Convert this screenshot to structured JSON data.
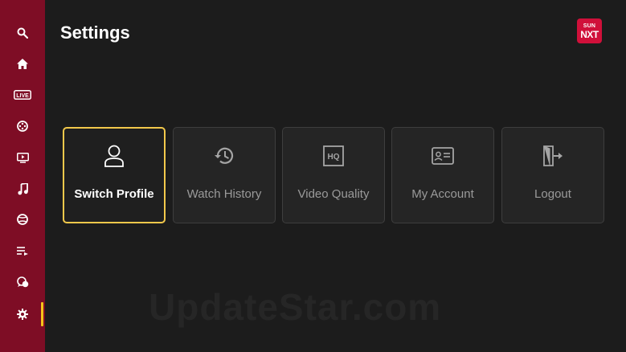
{
  "page": {
    "title": "Settings"
  },
  "logo": {
    "line1": "SUN",
    "line2": "NXT"
  },
  "sidebar": {
    "items": [
      {
        "name": "search",
        "icon": "search-icon"
      },
      {
        "name": "home",
        "icon": "home-icon"
      },
      {
        "name": "live",
        "icon": "live-icon",
        "label": "LIVE"
      },
      {
        "name": "movies",
        "icon": "film-reel-icon"
      },
      {
        "name": "tv-shows",
        "icon": "tv-play-icon"
      },
      {
        "name": "music",
        "icon": "music-note-icon"
      },
      {
        "name": "sports",
        "icon": "ball-icon"
      },
      {
        "name": "playlist",
        "icon": "playlist-icon"
      },
      {
        "name": "kids",
        "icon": "chat-bubbles-icon"
      },
      {
        "name": "settings",
        "icon": "gear-icon",
        "active": true
      }
    ]
  },
  "cards": [
    {
      "label": "Switch Profile",
      "icon": "user-icon",
      "selected": true
    },
    {
      "label": "Watch History",
      "icon": "history-icon"
    },
    {
      "label": "Video Quality",
      "icon": "hq-icon",
      "badge": "HQ"
    },
    {
      "label": "My Account",
      "icon": "id-card-icon"
    },
    {
      "label": "Logout",
      "icon": "exit-door-icon"
    }
  ],
  "watermark": "UpdateStar.com",
  "colors": {
    "sidebar": "#7e0d25",
    "background": "#1c1c1c",
    "focus": "#f2c84b",
    "brand": "#d0103a"
  }
}
